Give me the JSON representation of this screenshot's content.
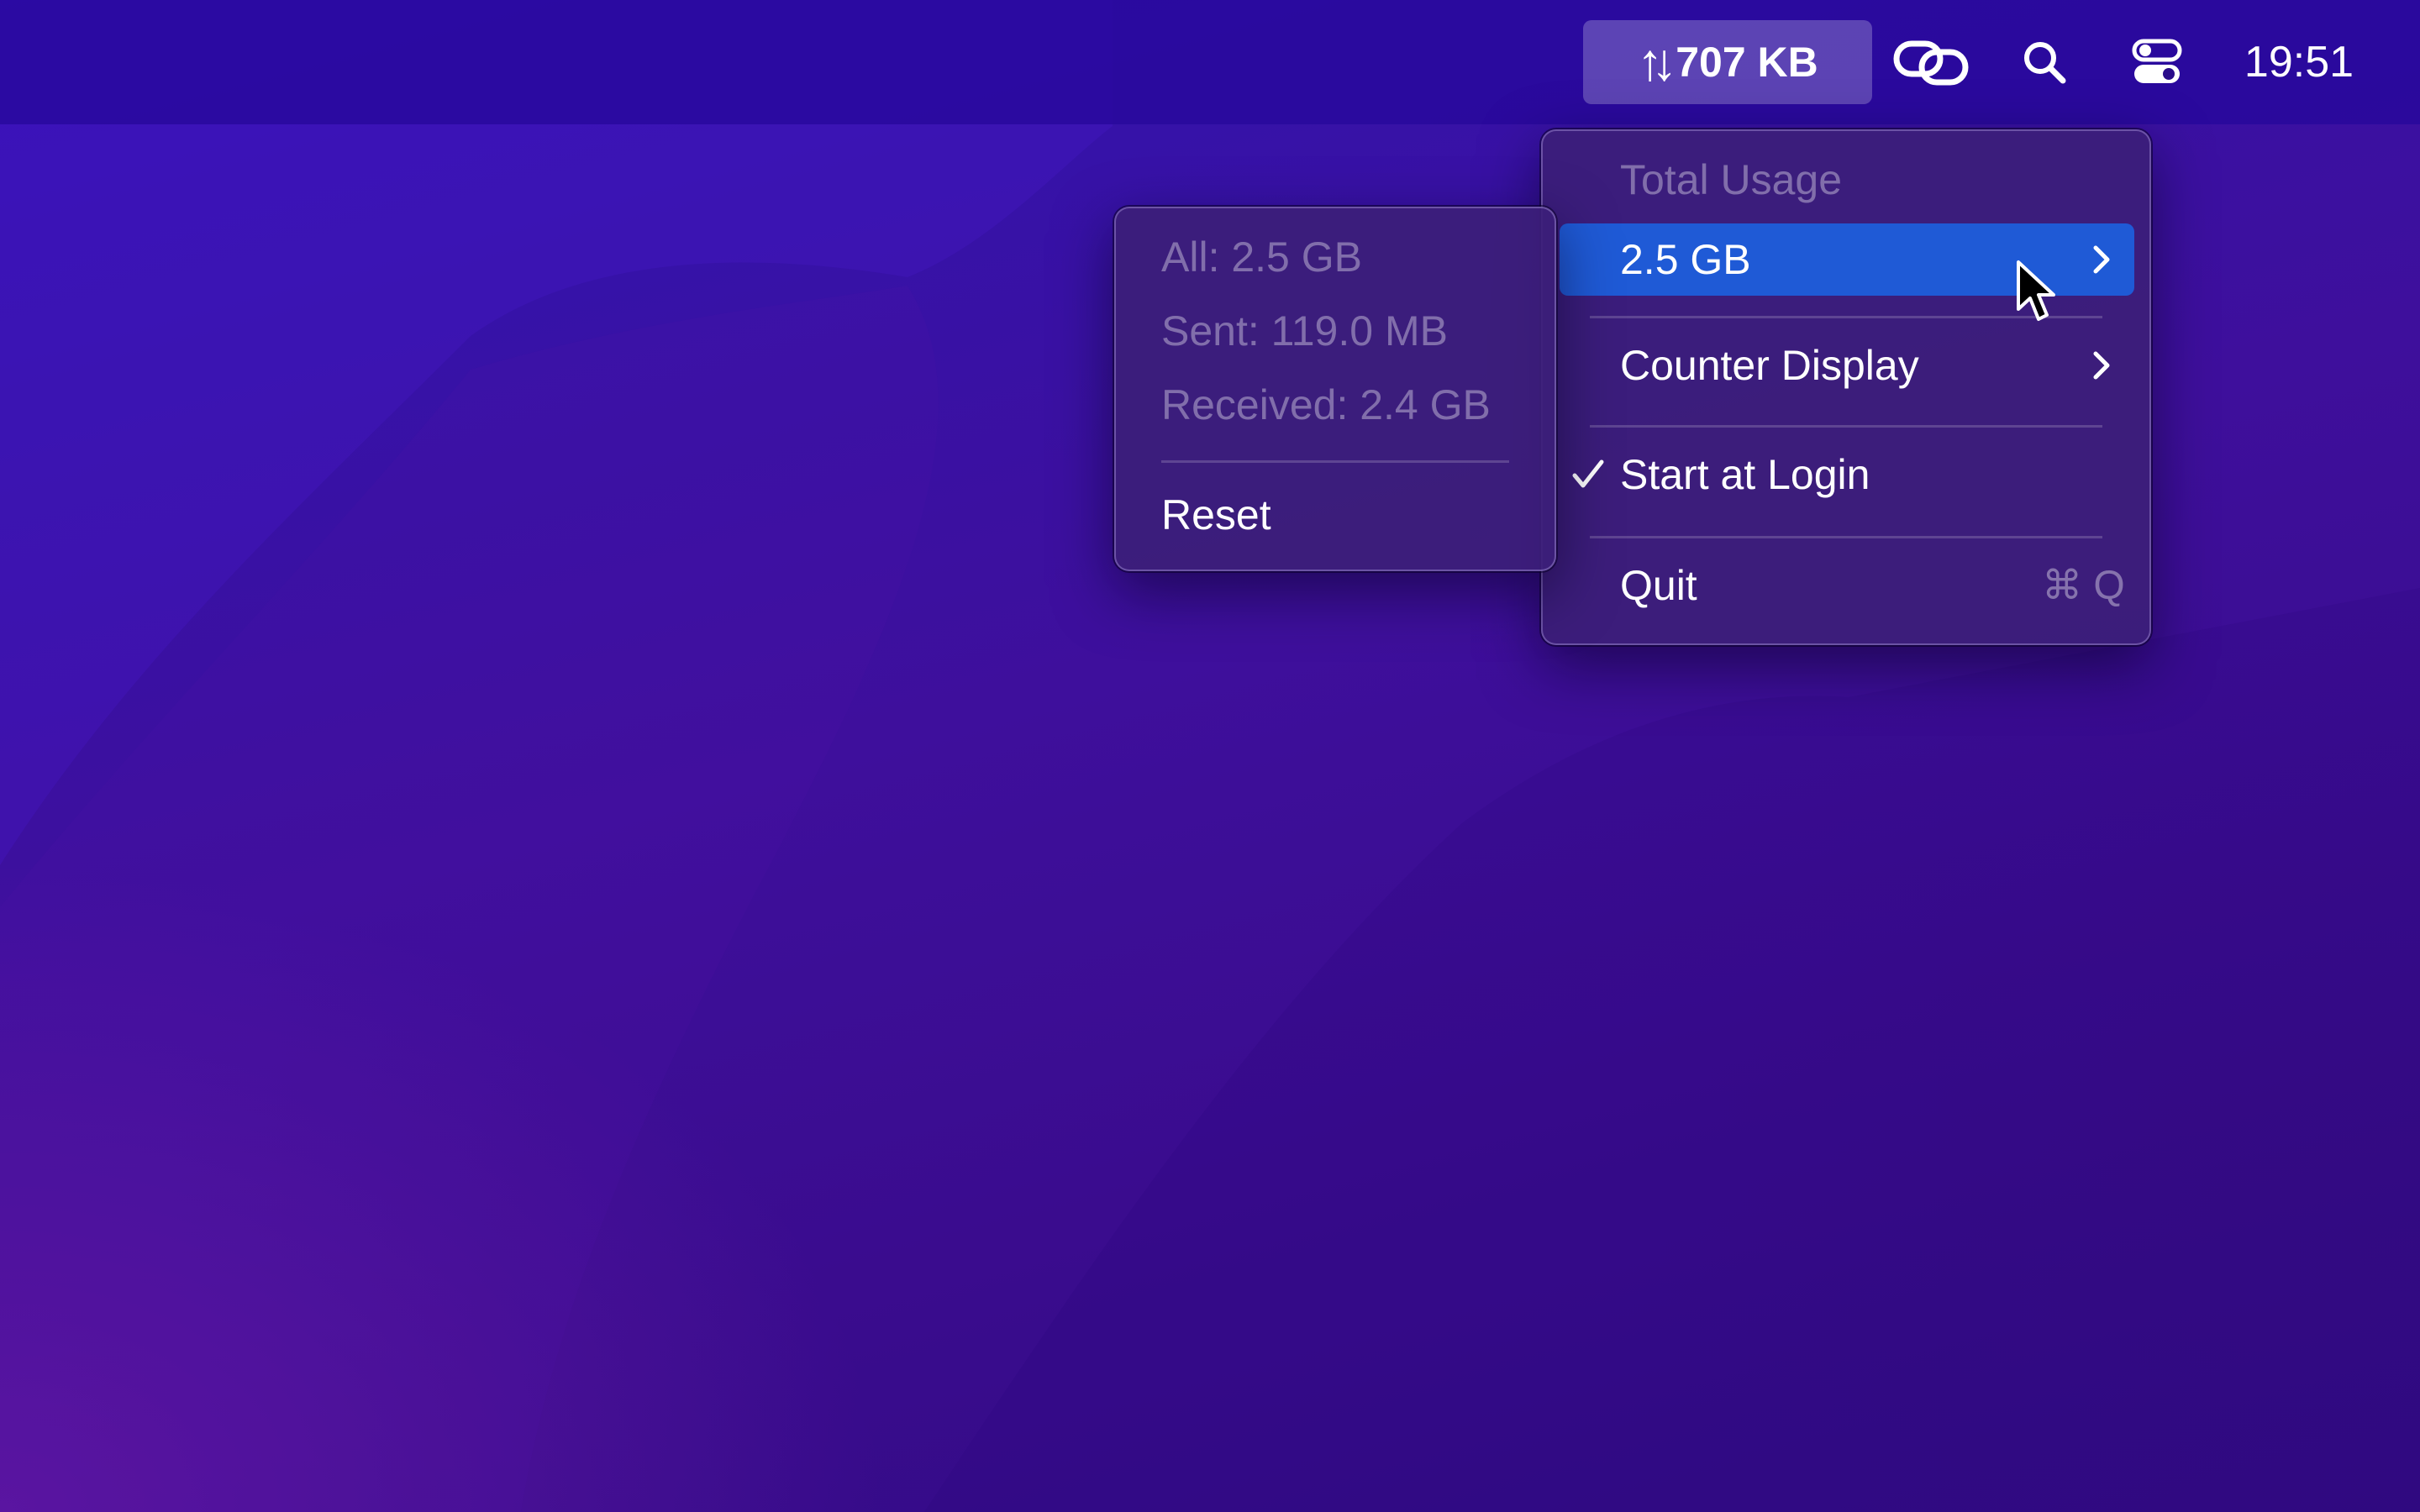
{
  "menubar": {
    "traffic_value": "707 KB",
    "traffic_icon": "up-down-arrows-icon",
    "clock": "19:51",
    "icons": [
      "link-icon",
      "search-icon",
      "control-center-icon"
    ]
  },
  "menu": {
    "header": "Total Usage",
    "total_item": "2.5 GB",
    "counter_display": "Counter Display",
    "start_at_login": "Start at Login",
    "start_at_login_checked": true,
    "quit": "Quit",
    "quit_shortcut": "⌘ Q"
  },
  "submenu": {
    "all": "All: 2.5 GB",
    "sent": "Sent: 119.0 MB",
    "received": "Received: 2.4 GB",
    "reset": "Reset"
  },
  "colors": {
    "highlight": "#1f5ad6",
    "menu_bg": "#3c1e78",
    "desktop": "#3a0c8e"
  }
}
